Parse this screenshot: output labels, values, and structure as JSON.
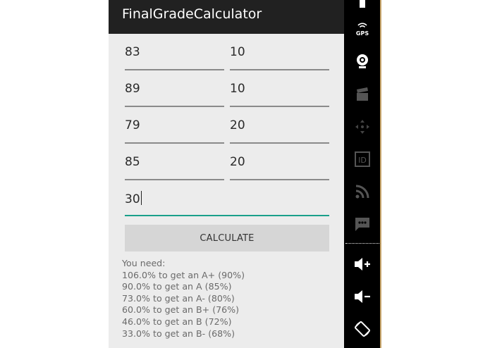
{
  "app": {
    "title": "FinalGradeCalculator"
  },
  "fields": [
    {
      "grade": "83",
      "weight": "10"
    },
    {
      "grade": "89",
      "weight": "10"
    },
    {
      "grade": "79",
      "weight": "20"
    },
    {
      "grade": "85",
      "weight": "20"
    }
  ],
  "final_weight": "30",
  "calculate_label": "CALCULATE",
  "results": {
    "heading": "You need:",
    "lines": [
      "106.0% to get an A+ (90%)",
      "90.0% to get an A (85%)",
      "73.0% to get an A- (80%)",
      "60.0% to get an B+ (76%)",
      "46.0% to get an B (72%)",
      "33.0% to get an B- (68%)"
    ]
  },
  "sidebar": {
    "gps_label": "GPS",
    "id_label": "ID",
    "icons": [
      "battery-icon",
      "gps-icon",
      "camera-icon",
      "clapperboard-icon",
      "dpad-icon",
      "id-icon",
      "rss-icon",
      "message-icon",
      "volume-up-icon",
      "volume-down-icon",
      "rotate-icon"
    ]
  },
  "colors": {
    "action_bar": "#212121",
    "accent": "#19a08a",
    "background": "#ececec"
  }
}
